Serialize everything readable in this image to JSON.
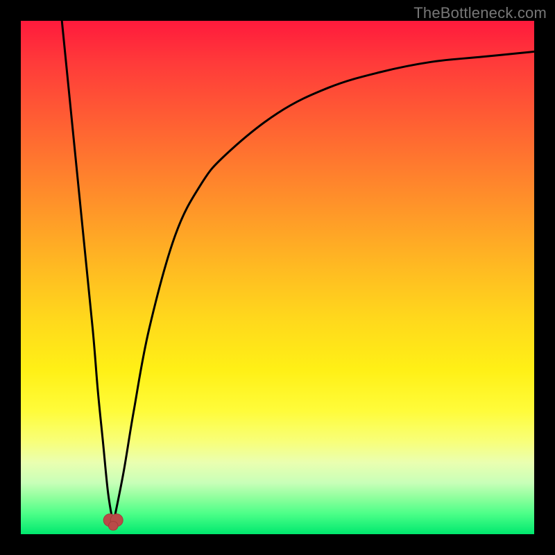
{
  "watermark": {
    "text": "TheBottleneck.com"
  },
  "colors": {
    "background": "#000000",
    "gradient_top": "#ff1a3c",
    "gradient_mid": "#fff016",
    "gradient_bottom": "#00e86e",
    "curve": "#000000",
    "minimum_marker": "#b94a48"
  },
  "chart_data": {
    "type": "line",
    "title": "",
    "xlabel": "",
    "ylabel": "",
    "xlim": [
      0,
      100
    ],
    "ylim": [
      0,
      100
    ],
    "grid": false,
    "legend": false,
    "annotations": [
      {
        "text": "TheBottleneck.com",
        "position": "top-right"
      }
    ],
    "minimum": {
      "x": 18,
      "y": 2
    },
    "series": [
      {
        "name": "left-branch",
        "x": [
          8,
          10,
          12,
          14,
          15,
          16,
          17,
          18
        ],
        "y": [
          100,
          80,
          60,
          40,
          28,
          18,
          8,
          2
        ]
      },
      {
        "name": "right-branch",
        "x": [
          18,
          20,
          22,
          25,
          30,
          35,
          40,
          50,
          60,
          70,
          80,
          90,
          100
        ],
        "y": [
          2,
          12,
          24,
          40,
          58,
          68,
          74,
          82,
          87,
          90,
          92,
          93,
          94
        ]
      }
    ],
    "background_gradient_stops": [
      {
        "pos": 0.0,
        "color": "#ff1a3c"
      },
      {
        "pos": 0.5,
        "color": "#ffd81c"
      },
      {
        "pos": 0.8,
        "color": "#fffc3a"
      },
      {
        "pos": 1.0,
        "color": "#00e86e"
      }
    ]
  }
}
